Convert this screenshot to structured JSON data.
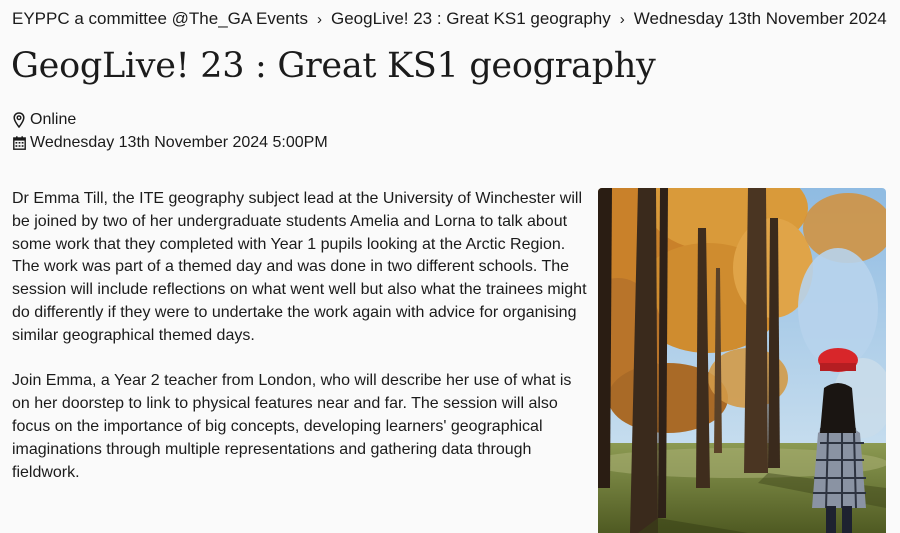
{
  "breadcrumb": {
    "items": [
      {
        "label": "EYPPC a committee @The_GA Events"
      },
      {
        "label": "GeogLive! 23 : Great KS1 geography"
      },
      {
        "label": "Wednesday 13th November 2024"
      }
    ],
    "separator": "›"
  },
  "event": {
    "title": "GeogLive! 23 : Great KS1 geography",
    "location": "Online",
    "datetime": "Wednesday 13th November 2024 5:00PM"
  },
  "description": {
    "paragraphs": [
      "Dr Emma Till, the ITE geography subject lead at the University of Winchester will be joined by two of her undergraduate students Amelia and Lorna to talk about some work that they completed with Year 1 pupils looking at the Arctic Region. The work was part of a themed day and was done in two different schools. The session will include reflections on what went well but also what the trainees might do differently if they were to undertake the work again with advice for organising similar geographical themed days.",
      "Join Emma, a Year 2 teacher from London, who will describe her use of what is on her doorstep to link to physical features near and far. The session will also focus on the importance of big concepts, developing learners' geographical imaginations through multiple representations and gathering data through fieldwork."
    ]
  },
  "icons": {
    "location": "map-pin-icon",
    "date": "calendar-icon"
  },
  "colors": {
    "background": "#fafafa",
    "text": "#1b1b1b",
    "foliage": "#d9952f",
    "sky": "#9cc4e4",
    "grass": "#7a8a3c",
    "hat": "#d8262a"
  }
}
